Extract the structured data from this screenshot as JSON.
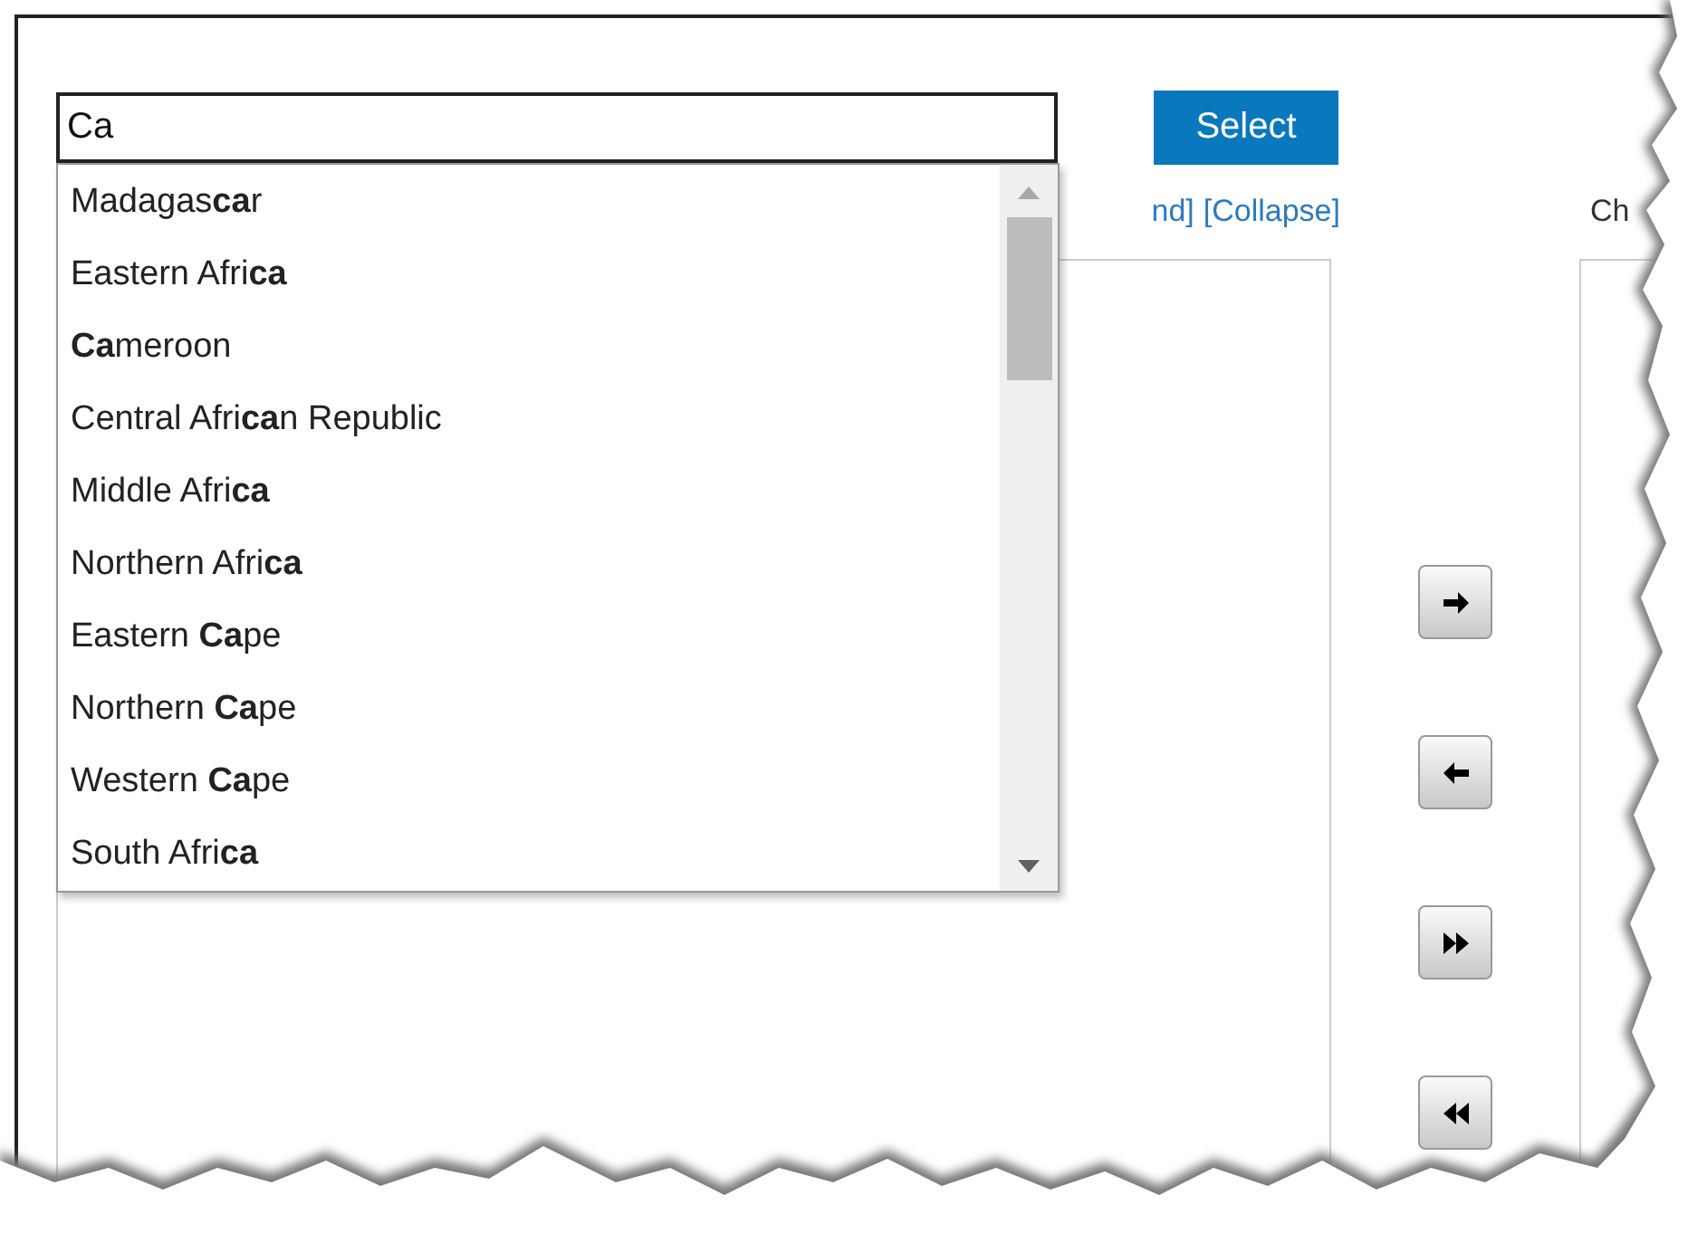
{
  "search": {
    "value": "Ca"
  },
  "select_button": "Select",
  "suggestions": [
    {
      "text": "Madagas**ca**r"
    },
    {
      "text": "Eastern Afri**ca**"
    },
    {
      "text": "**Ca**meroon"
    },
    {
      "text": "Central Afri**ca**n Republic"
    },
    {
      "text": "Middle Afri**ca**"
    },
    {
      "text": "Northern Afri**ca**"
    },
    {
      "text": "Eastern **Ca**pe"
    },
    {
      "text": "Northern **Ca**pe"
    },
    {
      "text": "Western **Ca**pe"
    },
    {
      "text": "South Afri**ca**"
    }
  ],
  "tree_links": [
    "nd]",
    "[Collapse]"
  ],
  "right_panel_label": "Ch",
  "transfer_buttons": [
    {
      "kind": "move-right"
    },
    {
      "kind": "move-left"
    },
    {
      "kind": "move-all-right"
    },
    {
      "kind": "move-all-left"
    }
  ]
}
